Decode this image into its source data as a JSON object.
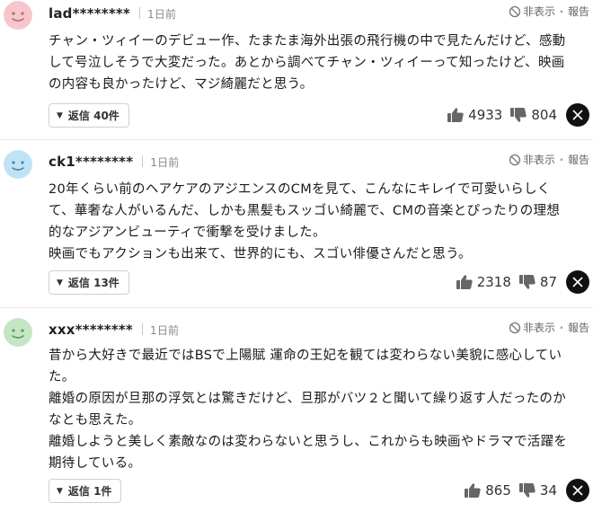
{
  "colors": {
    "avatar_pink": "#f5c6cb",
    "avatar_blue": "#bfe3f5",
    "avatar_green": "#c4e6c4",
    "x_button": "#111111"
  },
  "comments": [
    {
      "user": "lad********",
      "time": "1日前",
      "hide_label": "非表示",
      "report_label": "報告",
      "lines": [
        "チャン・ツィイーのデビュー作、たまたま海外出張の飛行機の中で見たんだけど、感動",
        "して号泣しそうで大変だった。あとから調べてチャン・ツィイーって知ったけど、映画",
        "の内容も良かったけど、マジ綺麗だと思う。"
      ],
      "reply_label": "返信 40件",
      "likes": "4933",
      "dislikes": "804",
      "avatar_icon": "default-avatar-pink"
    },
    {
      "user": "ck1********",
      "time": "1日前",
      "hide_label": "非表示",
      "report_label": "報告",
      "lines": [
        "20年くらい前のヘアケアのアジエンスのCMを見て、こんなにキレイで可愛いらしく",
        "て、華奢な人がいるんだ、しかも黒髪もスッゴい綺麗で、CMの音楽とぴったりの理想",
        "的なアジアンビューティで衝撃を受けました。",
        "映画でもアクションも出来て、世界的にも、スゴい俳優さんだと思う。"
      ],
      "reply_label": "返信 13件",
      "likes": "2318",
      "dislikes": "87",
      "avatar_icon": "default-avatar-blue"
    },
    {
      "user": "xxx********",
      "time": "1日前",
      "hide_label": "非表示",
      "report_label": "報告",
      "lines": [
        "昔から大好きで最近ではBSで上陽賦 運命の王妃を観ては変わらない美貌に感心してい",
        "た。",
        "離婚の原因が旦那の浮気とは驚きだけど、旦那がバツ２と聞いて繰り返す人だったのか",
        "なとも思えた。",
        "離婚しようと美しく素敵なのは変わらないと思うし、これからも映画やドラマで活躍を",
        "期待している。"
      ],
      "reply_label": "返信 1件",
      "likes": "865",
      "dislikes": "34",
      "avatar_icon": "default-avatar-green"
    }
  ]
}
